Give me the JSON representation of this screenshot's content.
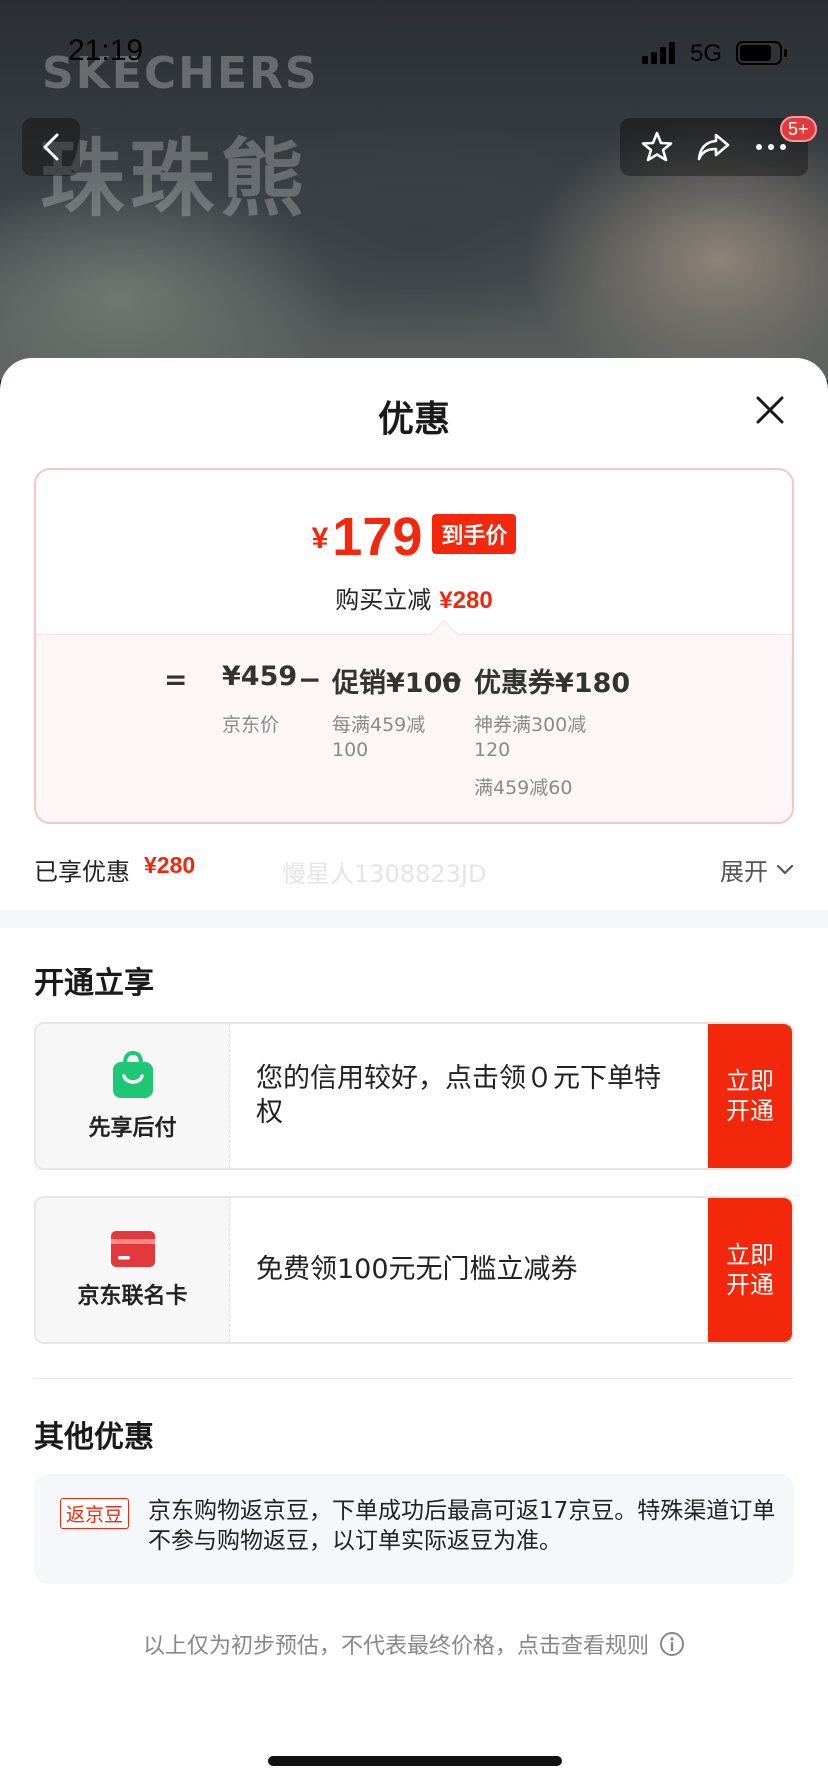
{
  "status_bar": {
    "time": "21:19",
    "network": "5G",
    "battery_level": 0.85
  },
  "background": {
    "brand_latin": "SKECHERS",
    "brand_cn": "珠珠熊"
  },
  "nav": {
    "badge_count": "5+"
  },
  "sheet": {
    "title": "优惠",
    "price": {
      "currency": "¥",
      "value": "179",
      "tag": "到手价",
      "subtitle": "购买立减",
      "subtitle_amount": "¥280"
    },
    "breakdown": {
      "equals": "=",
      "minus": "−",
      "items": [
        {
          "value": "¥459",
          "caption": "京东价"
        },
        {
          "value": "促销¥100",
          "caption_lines": [
            "每满459减",
            "100"
          ]
        },
        {
          "value": "优惠券¥180",
          "caption_lines": [
            "神券满300减",
            "120"
          ],
          "extra": "满459减60"
        }
      ]
    },
    "enjoyed": {
      "label": "已享优惠",
      "amount": "¥280",
      "watermark": "慢星人1308823JD",
      "expand_label": "展开"
    }
  },
  "instant": {
    "title": "开通立享",
    "cards": [
      {
        "label": "先享后付",
        "desc": "您的信用较好，点击领０元下单特权",
        "button": "立即开通",
        "icon": "shopping-bag-icon"
      },
      {
        "label": "京东联名卡",
        "desc": "免费领100元无门槛立减券",
        "button": "立即开通",
        "icon": "credit-card-icon"
      }
    ]
  },
  "other": {
    "title": "其他优惠",
    "bean_tag": "返京豆",
    "bean_text": "京东购物返京豆，下单成功后最高可返17京豆。特殊渠道订单不参与购物返豆，以订单实际返豆为准。"
  },
  "footer": {
    "note": "以上仅为初步预估，不代表最终价格，点击查看规则"
  },
  "colors": {
    "accent": "#f2270c",
    "green": "#1ec773",
    "card_red": "#e4393c"
  }
}
